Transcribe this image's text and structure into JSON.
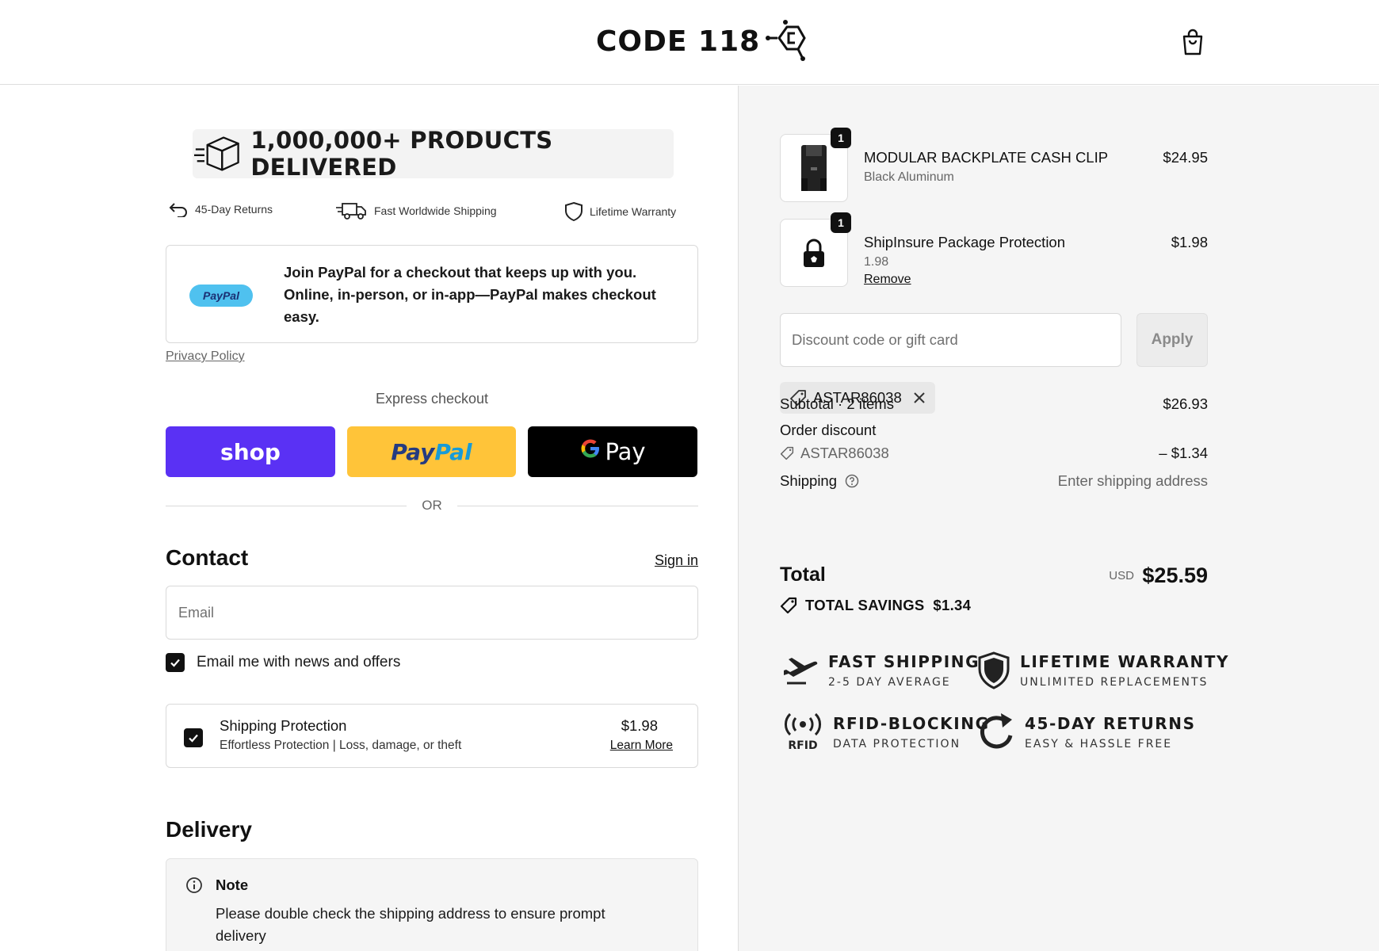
{
  "header": {
    "logo_text": "CODE 118"
  },
  "banner": {
    "text": "1,000,000+ PRODUCTS DELIVERED"
  },
  "perks": {
    "returns": "45-Day Returns",
    "shipping": "Fast Worldwide Shipping",
    "warranty": "Lifetime Warranty"
  },
  "paypal_promo": {
    "badge": "PayPal",
    "text": "Join PayPal for a checkout that keeps up with you. Online, in-person, or in-app—PayPal makes checkout easy.",
    "privacy": "Privacy Policy"
  },
  "express": {
    "label": "Express checkout",
    "shop": "shop",
    "paypal_1": "Pay",
    "paypal_2": "Pal",
    "gpay_g": "G",
    "gpay_label": "Pay",
    "or": "OR"
  },
  "contact": {
    "title": "Contact",
    "signin": "Sign in",
    "email_placeholder": "Email",
    "news_label": "Email me with news and offers"
  },
  "protection": {
    "title": "Shipping Protection",
    "subtitle": "Effortless Protection | Loss, damage, or theft",
    "price": "$1.98",
    "learn_more": "Learn More"
  },
  "delivery": {
    "title": "Delivery",
    "note_title": "Note",
    "note_text": "Please double check the shipping address to ensure prompt delivery"
  },
  "cart": {
    "items": [
      {
        "qty": "1",
        "name": "MODULAR BACKPLATE CASH CLIP",
        "variant": "Black Aluminum",
        "price": "$24.95"
      },
      {
        "qty": "1",
        "name": "ShipInsure Package Protection",
        "variant": "1.98",
        "price": "$1.98",
        "remove": "Remove"
      }
    ],
    "discount_placeholder": "Discount code or gift card",
    "apply": "Apply",
    "applied_code": "ASTAR86038",
    "subtotal_label": "Subtotal · 2 items",
    "subtotal": "$26.93",
    "order_discount_label": "Order discount",
    "discount_code": "ASTAR86038",
    "discount_amount": "– $1.34",
    "shipping_label": "Shipping",
    "shipping_value": "Enter shipping address",
    "total_label": "Total",
    "currency": "USD",
    "total": "$25.59",
    "savings": "TOTAL SAVINGS  $1.34"
  },
  "badges": {
    "fast_title": "FAST SHIPPING",
    "fast_sub": "2-5 DAY AVERAGE",
    "warranty_title": "LIFETIME WARRANTY",
    "warranty_sub": "UNLIMITED REPLACEMENTS",
    "rfid_title": "RFID-BLOCKING",
    "rfid_sub": "DATA PROTECTION",
    "rfid_icon_label": "RFID",
    "returns_title": "45-DAY RETURNS",
    "returns_sub": "EASY & HASSLE FREE"
  }
}
